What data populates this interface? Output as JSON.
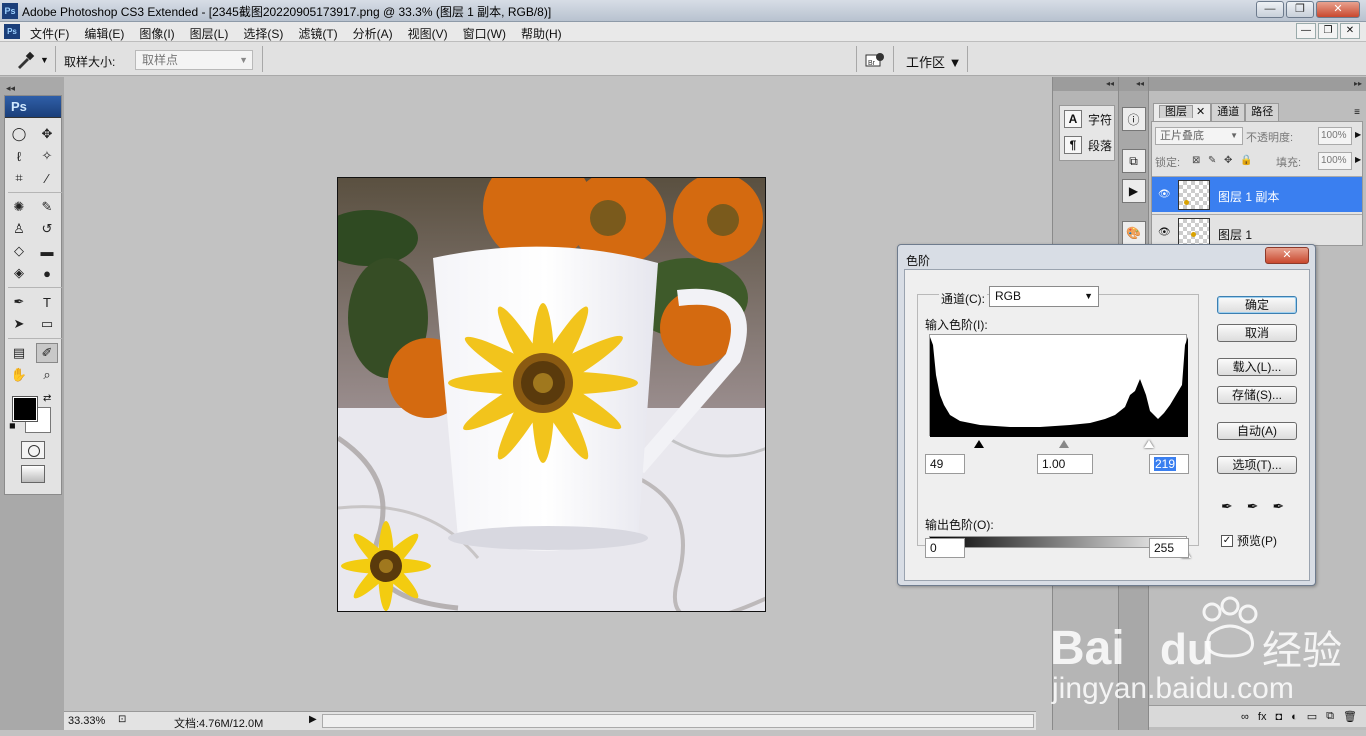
{
  "window": {
    "title": "Adobe Photoshop CS3 Extended - [2345截图20220905173917.png @ 33.3% (图层 1 副本, RGB/8)]",
    "app_icon": "Ps"
  },
  "menu": [
    "文件(F)",
    "编辑(E)",
    "图像(I)",
    "图层(L)",
    "选择(S)",
    "滤镜(T)",
    "分析(A)",
    "视图(V)",
    "窗口(W)",
    "帮助(H)"
  ],
  "options": {
    "sample_size_label": "取样大小:",
    "sample_size_value": "取样点",
    "workspace_label": "工作区"
  },
  "toolbox": {
    "logo": "Ps"
  },
  "status": {
    "zoom": "33.33%",
    "doc_size": "文档:4.76M/12.0M"
  },
  "side_panels": {
    "char_label": "字符",
    "para_label": "段落"
  },
  "layers_panel": {
    "tabs": [
      "图层",
      "通道",
      "路径"
    ],
    "blend_mode": "正片叠底",
    "opacity_label": "不透明度:",
    "opacity_value": "100%",
    "lock_label": "锁定:",
    "fill_label": "填充:",
    "fill_value": "100%",
    "layers": [
      {
        "name": "图层 1 副本",
        "selected": true
      },
      {
        "name": "图层 1",
        "selected": false
      }
    ]
  },
  "levels_dialog": {
    "title": "色阶",
    "channel_label": "通道(C):",
    "channel_value": "RGB",
    "input_label": "输入色阶(I):",
    "input_black": "49",
    "input_gamma": "1.00",
    "input_white": "219",
    "output_label": "输出色阶(O):",
    "output_black": "0",
    "output_white": "255",
    "buttons": {
      "ok": "确定",
      "cancel": "取消",
      "load": "载入(L)...",
      "save": "存储(S)...",
      "auto": "自动(A)",
      "options": "选项(T)..."
    },
    "preview_label": "预览(P)",
    "preview_checked": true
  },
  "watermark": {
    "brand": "Bai",
    "brand2": "du",
    "cn": "经验",
    "url": "jingyan.baidu.com"
  }
}
